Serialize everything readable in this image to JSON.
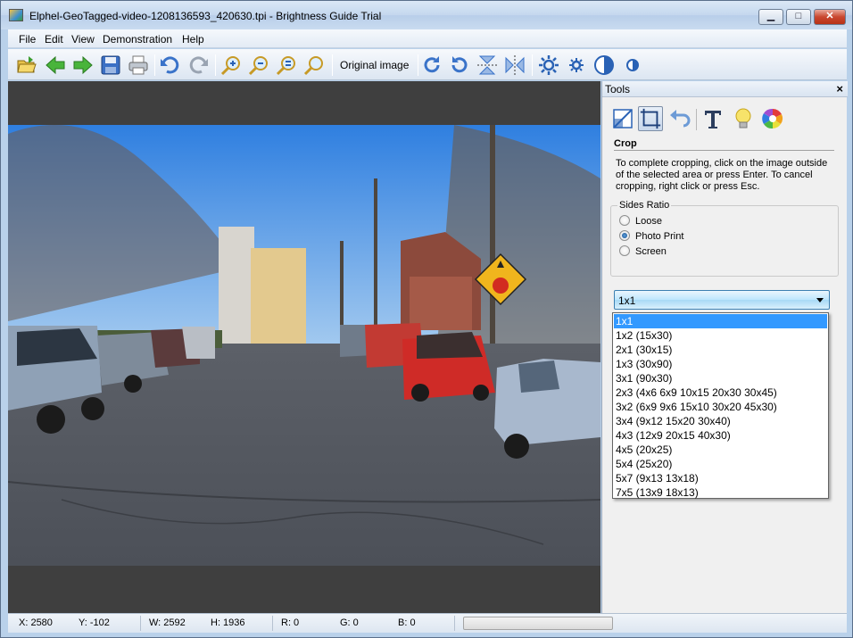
{
  "window": {
    "title": "Elphel-GeoTagged-video-1208136593_420630.tpi - Brightness Guide Trial",
    "minimize_glyph": "▁",
    "maximize_glyph": "□",
    "close_glyph": "✕"
  },
  "menu": [
    "File",
    "Edit",
    "View",
    "Demonstration",
    "Help"
  ],
  "toolbar": {
    "original_image_label": "Original image",
    "icons": [
      "open-folder-icon",
      "back-arrow-icon",
      "forward-arrow-icon",
      "save-icon",
      "print-icon",
      "undo-icon",
      "redo-icon",
      "zoom-in-icon",
      "zoom-out-icon",
      "zoom-fit-icon",
      "zoom-actual-icon",
      "rotate-right-icon",
      "rotate-left-icon",
      "flip-vertical-icon",
      "flip-horizontal-icon",
      "brightness-up-icon",
      "brightness-down-icon",
      "contrast-up-icon",
      "contrast-down-icon"
    ]
  },
  "tools_panel": {
    "title": "Tools",
    "close_glyph": "×",
    "tool_icons": [
      "resize-icon",
      "crop-icon",
      "undo-icon",
      "text-icon",
      "light-bulb-icon",
      "color-wheel-icon"
    ],
    "section_title": "Crop",
    "help_text": "To complete cropping, click on the image outside of the selected area or press Enter. To cancel cropping, right click or press Esc.",
    "sides_ratio": {
      "legend": "Sides Ratio",
      "options": [
        "Loose",
        "Photo Print",
        "Screen"
      ],
      "selected": "Photo Print"
    },
    "ratio_combo": {
      "value": "1x1",
      "options": [
        "1x1",
        "1x2 (15x30)",
        "2x1 (30x15)",
        "1x3 (30x90)",
        "3x1 (90x30)",
        "2x3 (4x6 6x9 10x15 20x30 30x45)",
        "3x2 (6x9 9x6 15x10 30x20 45x30)",
        "3x4 (9x12 15x20 30x40)",
        "4x3 (12x9 20x15 40x30)",
        "4x5 (20x25)",
        "5x4 (25x20)",
        "5x7 (9x13 13x18)",
        "7x5 (13x9 18x13)"
      ]
    }
  },
  "statusbar": {
    "x": "X: 2580",
    "y": "Y: -102",
    "w": "W: 2592",
    "h": "H: 1936",
    "r": "R: 0",
    "g": "G: 0",
    "b": "B: 0",
    "progress_fraction": 0.0
  },
  "colors": {
    "accent": "#3399ff",
    "window_frame": "#b9d1ea",
    "canvas_bg": "#3f3f3f"
  }
}
